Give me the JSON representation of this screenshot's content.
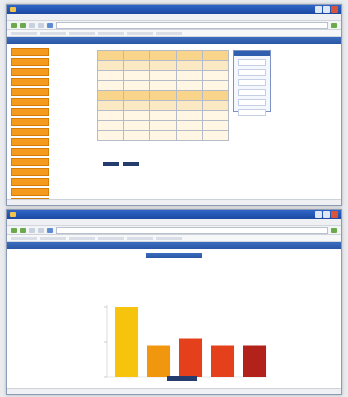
{
  "window1": {
    "title": "",
    "menu": [
      "",
      "",
      "",
      "",
      "",
      ""
    ],
    "url": "",
    "page_header": "",
    "sidebar_items": [
      "",
      "",
      "",
      "",
      "",
      "",
      "",
      "",
      "",
      "",
      "",
      "",
      "",
      "",
      "",
      "",
      ""
    ],
    "table": {
      "rows": [
        {
          "kind": "hdr",
          "cells": [
            "",
            "",
            "",
            "",
            ""
          ]
        },
        {
          "kind": "sub",
          "cells": [
            "",
            "",
            "",
            "",
            ""
          ]
        },
        {
          "kind": "alt",
          "cells": [
            "",
            "",
            "",
            "",
            ""
          ]
        },
        {
          "kind": "alt",
          "cells": [
            "",
            "",
            "",
            "",
            ""
          ]
        },
        {
          "kind": "hdr",
          "cells": [
            "",
            "",
            "",
            "",
            ""
          ]
        },
        {
          "kind": "sub",
          "cells": [
            "",
            "",
            "",
            "",
            ""
          ]
        },
        {
          "kind": "alt",
          "cells": [
            "",
            "",
            "",
            "",
            ""
          ]
        },
        {
          "kind": "alt",
          "cells": [
            "",
            "",
            "",
            "",
            ""
          ]
        },
        {
          "kind": "alt",
          "cells": [
            "",
            "",
            "",
            "",
            ""
          ]
        }
      ]
    },
    "panel_title": "",
    "panel_items": [
      "",
      "",
      "",
      "",
      "",
      ""
    ]
  },
  "window2": {
    "title": "",
    "url": "",
    "page_header": "",
    "chart_header": "",
    "chart_lines": [
      "",
      "",
      ""
    ],
    "legend_button": ""
  },
  "colors": {
    "bar_yellow": "#f6c40c",
    "bar_orange": "#f1960f",
    "bar_red": "#e3401b",
    "bar_darkred": "#b3211b",
    "nav_orange": "#f39a1f",
    "header_blue": "#2b57a5"
  },
  "chart_data": {
    "type": "bar",
    "categories": [
      "",
      "",
      "",
      "",
      ""
    ],
    "series": [
      {
        "values": [
          100,
          45,
          0,
          45,
          45
        ]
      },
      {
        "values": [
          0,
          0,
          55,
          0,
          0
        ]
      }
    ],
    "bar_colors": [
      "#f6c40c",
      "#f1960f",
      "#e3401b",
      "#e3401b",
      "#b3211b"
    ],
    "ylim": [
      0,
      100
    ],
    "ylabel": "",
    "xlabel": "",
    "title": "",
    "grid": false
  }
}
